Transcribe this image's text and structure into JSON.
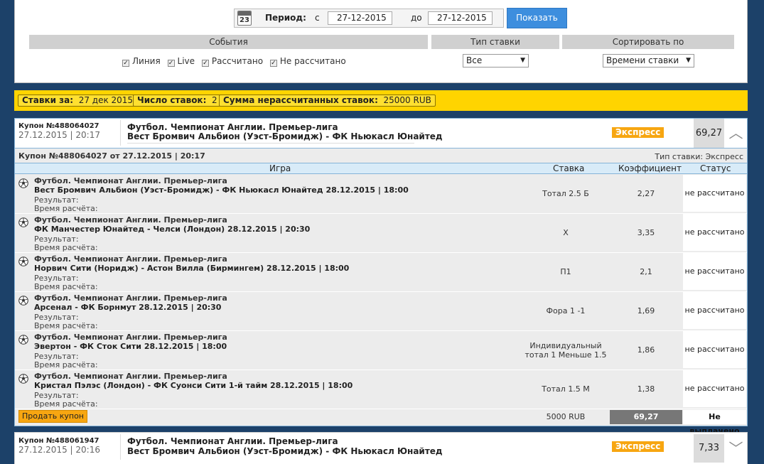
{
  "filter": {
    "period_label": "Период:",
    "from_label": "с",
    "from_date": "27-12-2015",
    "to_label": "до",
    "to_date": "27-12-2015",
    "show_label": "Показать",
    "calendar_day": "23",
    "events_header": "События",
    "bet_type_header": "Тип ставки",
    "sort_header": "Сортировать по",
    "checks": [
      {
        "label": "Линия",
        "checked": true
      },
      {
        "label": "Live",
        "checked": true
      },
      {
        "label": "Рассчитано",
        "checked": true
      },
      {
        "label": "Не рассчитано",
        "checked": true
      }
    ],
    "bet_type_value": "Все",
    "sort_value": "Времени ставки"
  },
  "summary": {
    "bets_for_label": "Ставки за:",
    "bets_for_value": "27 дек 2015",
    "count_label": "Число ставок:",
    "count_value": "2",
    "sum_label": "Сумма нерассчитанных ставок:",
    "sum_value": "25000 RUB"
  },
  "coupons": [
    {
      "number": "Купон №488064027",
      "date": "27.12.2015 | 20:17",
      "league": "Футбол. Чемпионат Англии. Премьер-лига",
      "match": "Вест Бромвич Альбион (Уэст-Бромидж) - ФК Ньюкасл Юнайтед",
      "badge": "Экспресс",
      "coef": "69,27"
    },
    {
      "number": "Купон №488061947",
      "date": "27.12.2015 | 20:16",
      "league": "Футбол. Чемпионат Англии. Премьер-лига",
      "match": "Вест Бромвич Альбион (Уэст-Бромидж) - ФК Ньюкасл Юнайтед",
      "badge": "Экспресс",
      "coef": "7,33"
    }
  ],
  "details": {
    "title": "Купон №488064027 от 27.12.2015 | 20:17",
    "bet_type_text": "Тип ставки: Экспресс",
    "columns": {
      "game": "Игра",
      "bet": "Ставка",
      "coef": "Коэффициент",
      "status": "Статус"
    },
    "result_label": "Результат:",
    "calc_time_label": "Время расчёта:",
    "rows": [
      {
        "league": "Футбол. Чемпионат Англии. Премьер-лига",
        "match": "Вест Бромвич Альбион (Уэст-Бромидж) - ФК Ньюкасл Юнайтед 28.12.2015 | 18:00",
        "bet": "Тотал 2.5 Б",
        "coef": "2,27",
        "status": "не рассчитано"
      },
      {
        "league": "Футбол. Чемпионат Англии. Премьер-лига",
        "match": "ФК Манчестер Юнайтед - Челси (Лондон) 28.12.2015 | 20:30",
        "bet": "Х",
        "coef": "3,35",
        "status": "не рассчитано"
      },
      {
        "league": "Футбол. Чемпионат Англии. Премьер-лига",
        "match": "Норвич Сити (Норидж) - Астон Вилла (Бирмингем) 28.12.2015 | 18:00",
        "bet": "П1",
        "coef": "2,1",
        "status": "не рассчитано"
      },
      {
        "league": "Футбол. Чемпионат Англии. Премьер-лига",
        "match": "Арсенал - ФК Борнмут 28.12.2015 | 20:30",
        "bet": "Фора 1 -1",
        "coef": "1,69",
        "status": "не рассчитано"
      },
      {
        "league": "Футбол. Чемпионат Англии. Премьер-лига",
        "match": "Эвертон - ФК Сток Сити 28.12.2015 | 18:00",
        "bet": "Индивидуальный тотал 1 Меньше 1.5",
        "coef": "1,86",
        "status": "не рассчитано"
      },
      {
        "league": "Футбол. Чемпионат Англии. Премьер-лига",
        "match": "Кристал Пэлэс (Лондон) - ФК Суонси Сити 1-й тайм 28.12.2015 | 18:00",
        "bet": "Тотал 1.5 М",
        "coef": "1,38",
        "status": "не рассчитано"
      }
    ],
    "sell_label": "Продать купон",
    "stake": "5000 RUB",
    "total_coef": "69,27",
    "payout_status": "Не выплачено"
  },
  "colors": {
    "accent": "#ffd400",
    "badge": "#f7a611",
    "button": "#3d8ede",
    "header_blue": "#d8ebf8"
  }
}
